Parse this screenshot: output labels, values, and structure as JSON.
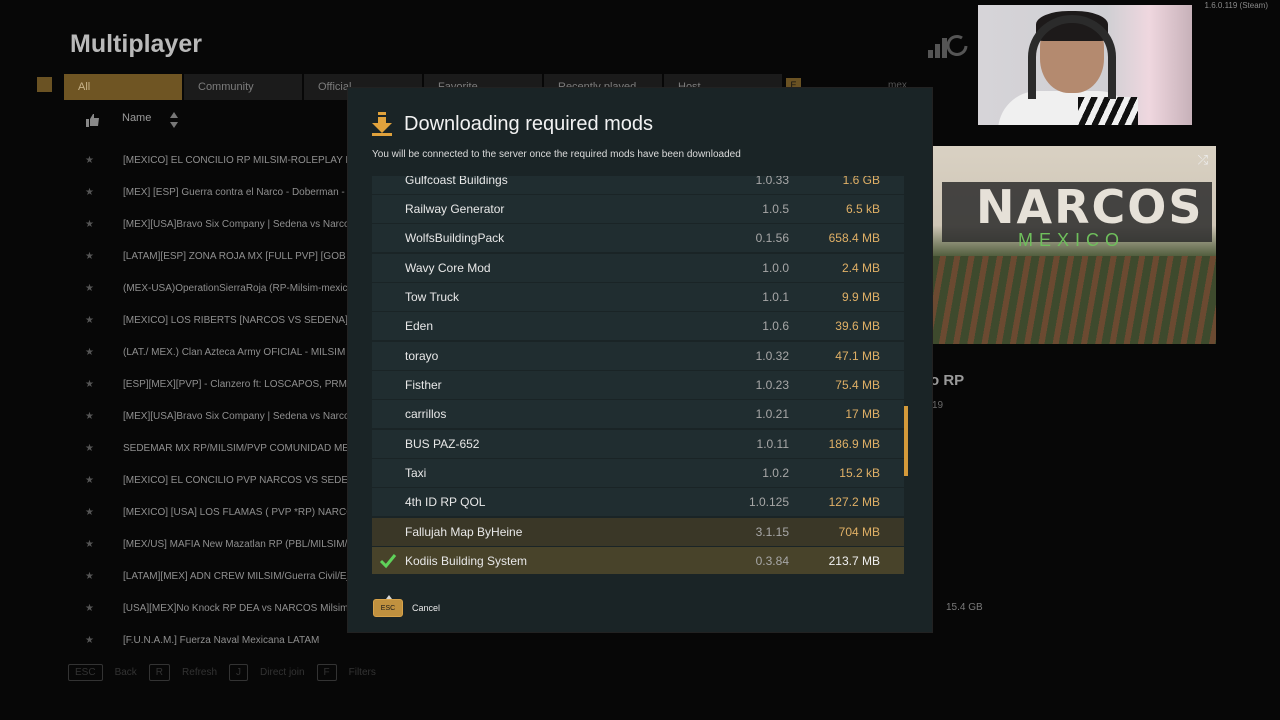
{
  "background": {
    "title": "Multiplayer",
    "version": "1.6.0.119 (Steam)",
    "tabs": [
      {
        "label": "All",
        "active": true
      },
      {
        "label": "Community"
      },
      {
        "label": "Official"
      },
      {
        "label": "Favorite"
      },
      {
        "label": "Recently played"
      },
      {
        "label": "Host"
      }
    ],
    "tab_badge": "E",
    "search_value": "mex",
    "columns": {
      "name": "Name"
    },
    "servers": [
      "[MEXICO] EL CONCILIO RP MILSIM-ROLEPLAY NARCOS",
      "[MEX] [ESP] Guerra contra el Narco - Doberman - Discord",
      "[MEX][USA]Bravo Six Company | Sedena vs Narcos Milsim",
      "[LATAM][ESP]  ZONA ROJA MX  [FULL PVP] [GOB vs NARCOS]",
      "(MEX-USA)OperationSierraRoja (RP-Milsim-mexico-usa)",
      "[MEXICO] LOS RIBERTS [NARCOS VS SEDENA] [MILSIM]",
      "(LAT./ MEX.) Clan Azteca Army OFICIAL - MILSIM en Español",
      "[ESP][MEX][PVP] - Clanzero ft: LOSCAPOS, PRM - Guerra",
      "[MEX][USA]Bravo Six Company | Sedena vs Narcos RP",
      "SEDEMAR MX RP/MILSIM/PVP COMUNIDAD MEXICANA",
      "[MEXICO] EL CONCILIO PVP  NARCOS VS SEDENA",
      "[MEXICO] [USA] LOS FLAMAS ( PVP *RP)  NARCOS VS SEDENA",
      "[MEX/US] MAFIA New Mazatlan RP (PBL/MILSIM/RP)",
      "[LATAM][MEX] ADN CREW MILSIM/Guerra Civil/Ejército",
      "[USA][MEX]No Knock RP DEA vs NARCOS Milsim /RP",
      "[F.U.N.A.M.] Fuerza Naval Mexicana LATAM"
    ],
    "bottom_keys": [
      {
        "key": "ESC",
        "label": "Back"
      },
      {
        "key": "R",
        "label": "Refresh"
      },
      {
        "key": "J",
        "label": "Direct join"
      },
      {
        "key": "F",
        "label": "Filters"
      }
    ],
    "preview": {
      "line1": "NARCOS",
      "line2": "MEXICO"
    },
    "server_title_partial": "o RP",
    "server_sub_partial": "19",
    "server_size": "15.4 GB"
  },
  "modal": {
    "title": "Downloading required mods",
    "subtitle": "You will be connected to the server once the required mods have been downloaded",
    "mods": [
      {
        "name": "Gulfcoast Buildings",
        "version": "1.0.33",
        "size": "1.6 GB"
      },
      {
        "name": "Railway Generator",
        "version": "1.0.5",
        "size": "6.5 kB"
      },
      {
        "name": "WolfsBuildingPack",
        "version": "0.1.56",
        "size": "658.4 MB"
      },
      {
        "name": "Wavy Core Mod",
        "version": "1.0.0",
        "size": "2.4 MB"
      },
      {
        "name": "Tow Truck",
        "version": "1.0.1",
        "size": "9.9 MB"
      },
      {
        "name": "Eden",
        "version": "1.0.6",
        "size": "39.6 MB"
      },
      {
        "name": "torayo",
        "version": "1.0.32",
        "size": "47.1 MB"
      },
      {
        "name": "Fisther",
        "version": "1.0.23",
        "size": "75.4 MB"
      },
      {
        "name": "carrillos",
        "version": "1.0.21",
        "size": "17 MB"
      },
      {
        "name": "BUS PAZ-652",
        "version": "1.0.11",
        "size": "186.9 MB"
      },
      {
        "name": "Taxi",
        "version": "1.0.2",
        "size": "15.2 kB"
      },
      {
        "name": "4th ID RP QOL",
        "version": "1.0.125",
        "size": "127.2 MB"
      },
      {
        "name": "Fallujah Map ByHeine",
        "version": "3.1.15",
        "size": "704 MB",
        "state": "highlighted"
      },
      {
        "name": "Kodiis Building System",
        "version": "0.3.84",
        "size": "213.7 MB",
        "state": "downloaded"
      }
    ],
    "esc_key": "ESC",
    "cancel_label": "Cancel"
  }
}
